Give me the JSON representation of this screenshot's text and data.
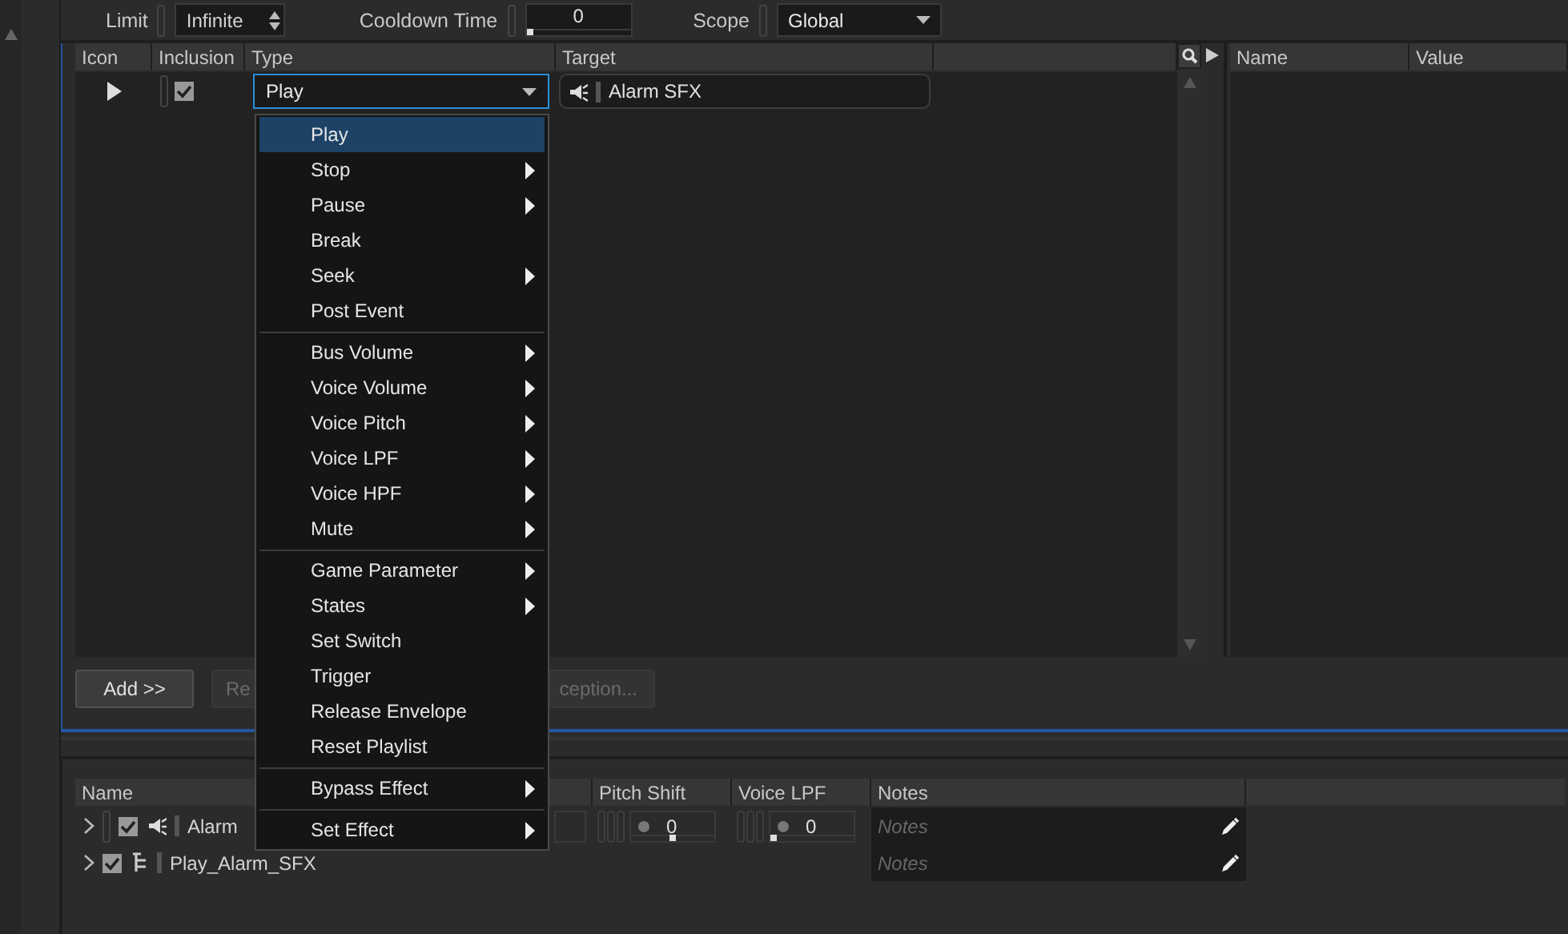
{
  "toolbar": {
    "limit_label": "Limit",
    "limit_value": "Infinite",
    "cooldown_label": "Cooldown Time",
    "cooldown": {
      "value": "0",
      "level": 0
    },
    "scope_label": "Scope",
    "scope_value": "Global"
  },
  "actions_table": {
    "columns": [
      "Icon",
      "Inclusion",
      "Type",
      "Target"
    ],
    "rows": [
      {
        "included": true,
        "type": "Play",
        "target": "Alarm SFX"
      }
    ]
  },
  "properties_table": {
    "columns": [
      "Name",
      "Value"
    ]
  },
  "buttons": [
    {
      "label": "Add >>",
      "disabled": false
    },
    {
      "label": "Re",
      "disabled": true
    },
    {
      "label": "ception...",
      "disabled": true
    }
  ],
  "type_menu": {
    "groups": [
      [
        {
          "label": "Play",
          "submenu": false,
          "selected": true
        },
        {
          "label": "Stop",
          "submenu": true,
          "selected": false
        },
        {
          "label": "Pause",
          "submenu": true,
          "selected": false
        },
        {
          "label": "Break",
          "submenu": false,
          "selected": false
        },
        {
          "label": "Seek",
          "submenu": true,
          "selected": false
        },
        {
          "label": "Post Event",
          "submenu": false,
          "selected": false
        }
      ],
      [
        {
          "label": "Bus Volume",
          "submenu": true,
          "selected": false
        },
        {
          "label": "Voice Volume",
          "submenu": true,
          "selected": false
        },
        {
          "label": "Voice Pitch",
          "submenu": true,
          "selected": false
        },
        {
          "label": "Voice LPF",
          "submenu": true,
          "selected": false
        },
        {
          "label": "Voice HPF",
          "submenu": true,
          "selected": false
        },
        {
          "label": "Mute",
          "submenu": true,
          "selected": false
        }
      ],
      [
        {
          "label": "Game Parameter",
          "submenu": true,
          "selected": false
        },
        {
          "label": "States",
          "submenu": true,
          "selected": false
        },
        {
          "label": "Set Switch",
          "submenu": false,
          "selected": false
        },
        {
          "label": "Trigger",
          "submenu": false,
          "selected": false
        },
        {
          "label": "Release Envelope",
          "submenu": false,
          "selected": false
        },
        {
          "label": "Reset Playlist",
          "submenu": false,
          "selected": false
        }
      ],
      [
        {
          "label": "Bypass Effect",
          "submenu": true,
          "selected": false
        }
      ],
      [
        {
          "label": "Set Effect",
          "submenu": true,
          "selected": false
        }
      ]
    ]
  },
  "objects_table": {
    "columns": [
      "Name",
      "Pitch Shift",
      "Voice LPF",
      "Notes"
    ],
    "rows": [
      {
        "kind": "sound",
        "name": "Alarm",
        "included": true,
        "pitch_shift": {
          "value": "0",
          "level": 0.5
        },
        "voice_lpf": {
          "value": "0",
          "level": 0
        },
        "notes_placeholder": "Notes"
      },
      {
        "kind": "event",
        "name": "Play_Alarm_SFX",
        "included": true,
        "notes_placeholder": "Notes"
      }
    ]
  }
}
